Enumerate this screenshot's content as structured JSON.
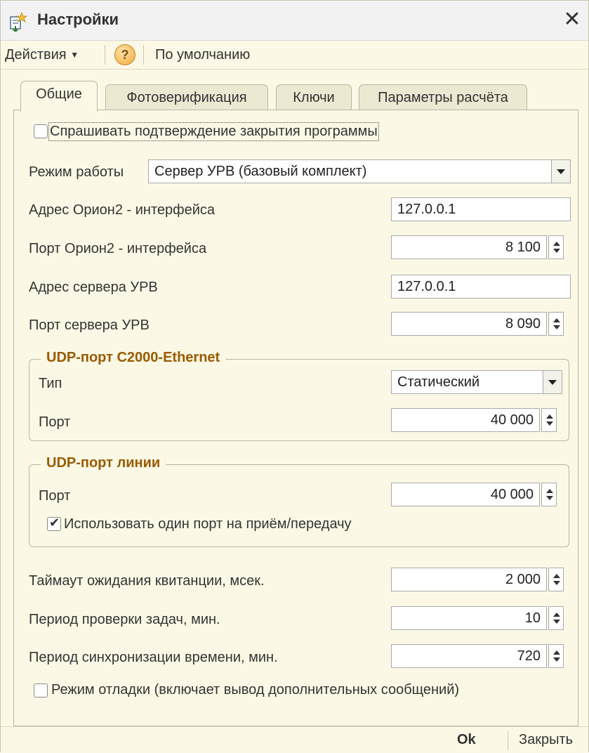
{
  "window": {
    "title": "Настройки"
  },
  "toolbar": {
    "actions_label": "Действия",
    "help_symbol": "?",
    "default_label": "По умолчанию"
  },
  "tabs": [
    {
      "label": "Общие",
      "active": true
    },
    {
      "label": "Фотоверификация",
      "active": false
    },
    {
      "label": "Ключи",
      "active": false
    },
    {
      "label": "Параметры расчёта",
      "active": false
    }
  ],
  "general": {
    "confirm_close": {
      "label": "Спрашивать подтверждение закрытия программы",
      "checked": false
    },
    "mode": {
      "label": "Режим работы",
      "value": "Сервер УРВ (базовый комплект)"
    },
    "orion_address": {
      "label": "Адрес Орион2 - интерфейса",
      "value": "127.0.0.1"
    },
    "orion_port": {
      "label": "Порт Орион2 - интерфейса",
      "value": "8 100"
    },
    "urv_address": {
      "label": "Адрес сервера УРВ",
      "value": "127.0.0.1"
    },
    "urv_port": {
      "label": "Порт сервера УРВ",
      "value": "8 090"
    }
  },
  "udp_c2000": {
    "title": "UDP-порт С2000-Ethernet",
    "type_label": "Тип",
    "type_value": "Статический",
    "port_label": "Порт",
    "port_value": "40 000"
  },
  "udp_line": {
    "title": "UDP-порт линии",
    "port_label": "Порт",
    "port_value": "40 000",
    "single_port": {
      "label": "Использовать один порт на приём/передачу",
      "checked": true
    }
  },
  "timing": {
    "ack_timeout": {
      "label": "Таймаут ожидания квитанции, мсек.",
      "value": "2 000"
    },
    "task_check": {
      "label": "Период проверки задач, мин.",
      "value": "10"
    },
    "time_sync": {
      "label": "Период синхронизации времени, мин.",
      "value": "720"
    }
  },
  "debug_mode": {
    "label": "Режим отладки (включает вывод дополнительных сообщений)",
    "checked": false
  },
  "footer": {
    "ok_label": "Ok",
    "close_label": "Закрыть"
  },
  "colors": {
    "window_bg": "#fbf9e6",
    "group_title": "#9a5a00",
    "border": "#b9b7a0"
  }
}
